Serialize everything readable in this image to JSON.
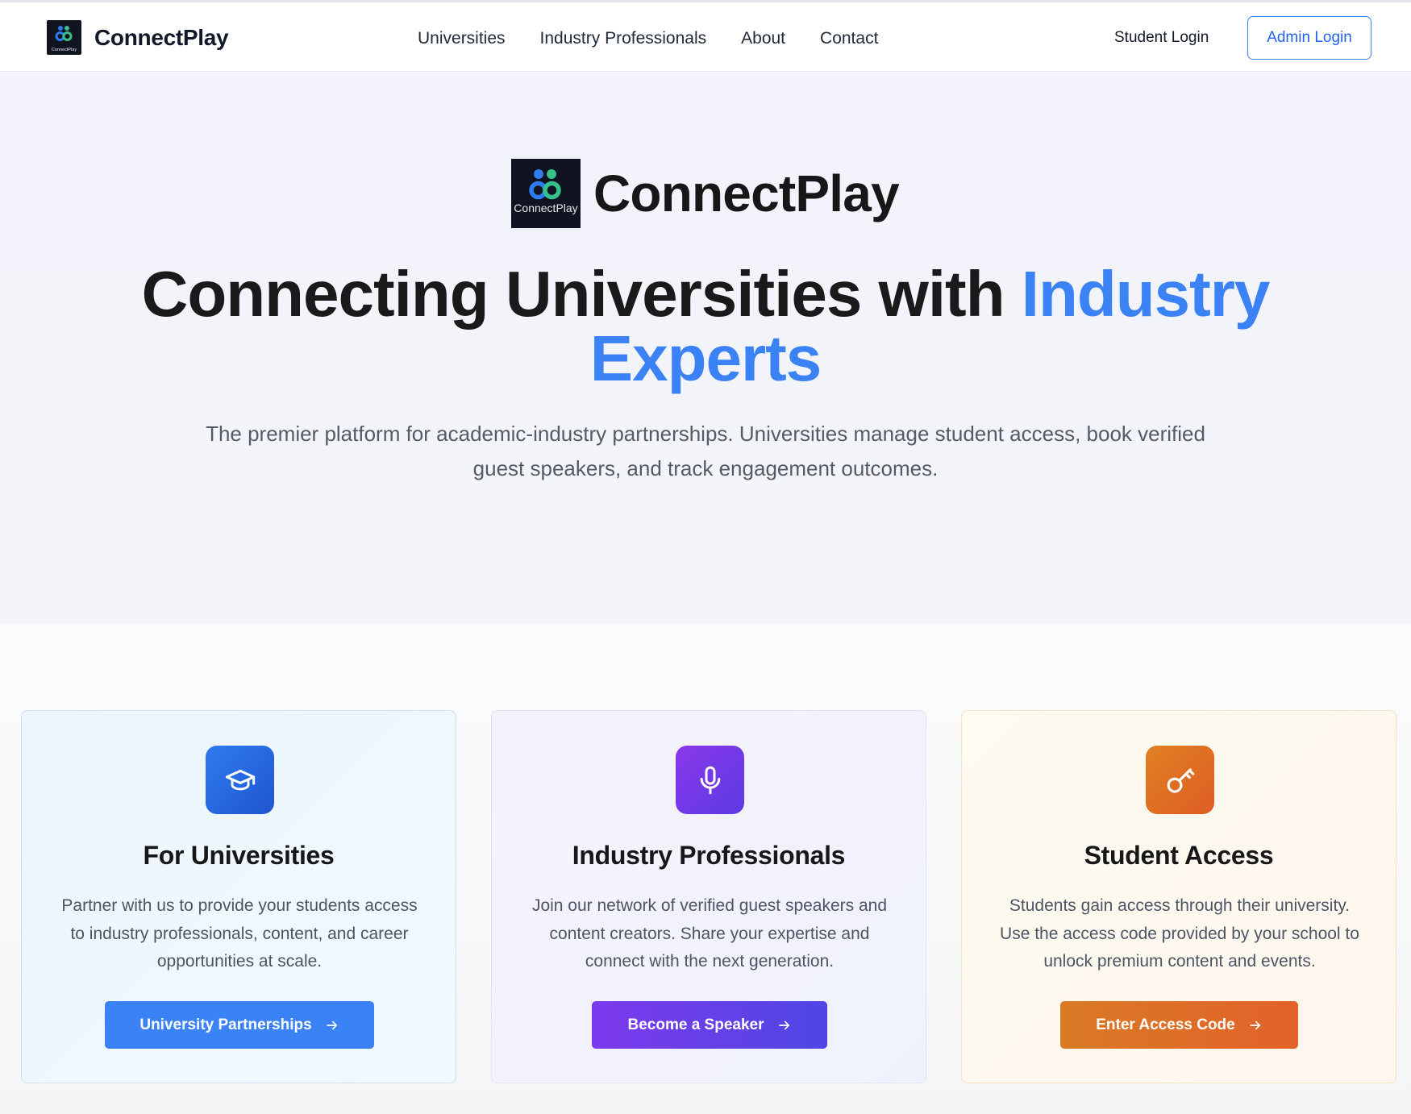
{
  "nav": {
    "brand": "ConnectPlay",
    "links": [
      "Universities",
      "Industry Professionals",
      "About",
      "Contact"
    ],
    "student_login": "Student Login",
    "admin_login": "Admin Login"
  },
  "hero": {
    "brand": "ConnectPlay",
    "logo_caption": "ConnectPlay",
    "title_main": "Connecting Universities with ",
    "title_accent": "Industry Experts",
    "subtitle": "The premier platform for academic-industry partnerships. Universities manage student access, book verified guest speakers, and track engagement outcomes."
  },
  "cards": [
    {
      "icon": "graduation-cap-icon",
      "title": "For Universities",
      "text": "Partner with us to provide your students access to industry professionals, content, and career opportunities at scale.",
      "button": "University Partnerships"
    },
    {
      "icon": "microphone-icon",
      "title": "Industry Professionals",
      "text": "Join our network of verified guest speakers and content creators. Share your expertise and connect with the next generation.",
      "button": "Become a Speaker"
    },
    {
      "icon": "key-icon",
      "title": "Student Access",
      "text": "Students gain access through their university. Use the access code provided by your school to unlock premium content and events.",
      "button": "Enter Access Code"
    }
  ],
  "colors": {
    "accent": "#3b82f6",
    "purple": "#7c3aed",
    "orange": "#e0702a"
  }
}
